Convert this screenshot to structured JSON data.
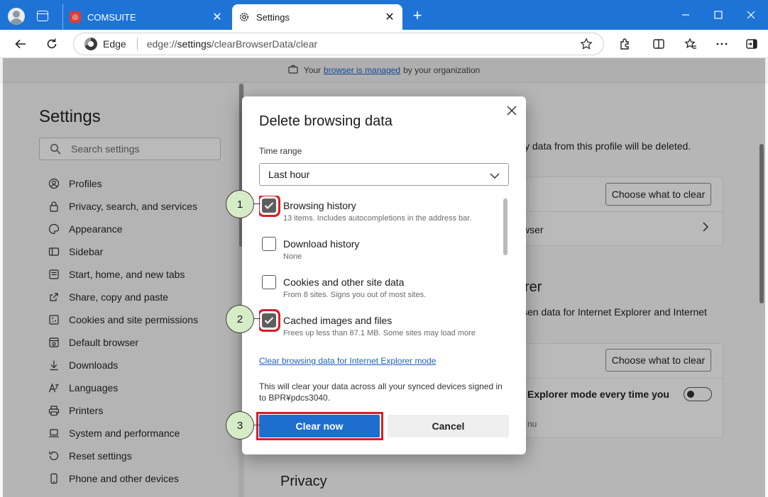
{
  "browser": {
    "tabs": [
      {
        "title": "COMSUITE",
        "active": false
      },
      {
        "title": "Settings",
        "active": true
      }
    ],
    "address": {
      "site_label": "Edge",
      "url_scheme": "edge://",
      "url_host": "settings",
      "url_path": "/clearBrowserData/clear"
    }
  },
  "banner": {
    "prefix": "Your",
    "link": "browser is managed",
    "suffix": "by your organization"
  },
  "sidebar": {
    "title": "Settings",
    "search_placeholder": "Search settings",
    "items": [
      {
        "label": "Profiles",
        "icon": "profile-icon"
      },
      {
        "label": "Privacy, search, and services",
        "icon": "lock-icon"
      },
      {
        "label": "Appearance",
        "icon": "palette-icon"
      },
      {
        "label": "Sidebar",
        "icon": "sidebar-icon"
      },
      {
        "label": "Start, home, and new tabs",
        "icon": "home-icon"
      },
      {
        "label": "Share, copy and paste",
        "icon": "share-icon"
      },
      {
        "label": "Cookies and site permissions",
        "icon": "cookies-icon"
      },
      {
        "label": "Default browser",
        "icon": "browser-icon"
      },
      {
        "label": "Downloads",
        "icon": "download-icon"
      },
      {
        "label": "Languages",
        "icon": "language-icon"
      },
      {
        "label": "Printers",
        "icon": "printer-icon"
      },
      {
        "label": "System and performance",
        "icon": "laptop-icon"
      },
      {
        "label": "Reset settings",
        "icon": "reset-icon"
      },
      {
        "label": "Phone and other devices",
        "icon": "phone-icon"
      }
    ]
  },
  "main": {
    "profile_note": "y data from this profile will be deleted.",
    "choose_label_1": "Choose what to clear",
    "row_browser": "wser",
    "heading_ie": "rer",
    "ie_desc": "sen data for Internet Explorer and Internet",
    "choose_label_2": "Choose what to clear",
    "ie_mode_label": "Explorer mode every time you",
    "ie_mode_sub": "nu",
    "privacy_heading": "Privacy"
  },
  "dialog": {
    "title": "Delete browsing data",
    "time_range_label": "Time range",
    "time_range_value": "Last hour",
    "options": [
      {
        "label": "Browsing history",
        "detail": "13 items. Includes autocompletions in the address bar.",
        "checked": true
      },
      {
        "label": "Download history",
        "detail": "None",
        "checked": false
      },
      {
        "label": "Cookies and other site data",
        "detail": "From 8 sites. Signs you out of most sites.",
        "checked": false
      },
      {
        "label": "Cached images and files",
        "detail": "Frees up less than 87.1 MB. Some sites may load more",
        "checked": true
      }
    ],
    "ie_link": "Clear browsing data for Internet Explorer mode",
    "sync_note": "This will clear your data across all your synced devices signed in to BPR¥pdcs3040.",
    "clear_label": "Clear now",
    "cancel_label": "Cancel"
  },
  "markers": [
    "1",
    "2",
    "3"
  ],
  "colors": {
    "titlebar": "#1e73d6",
    "primary_button": "#1d6ecf",
    "highlight": "#d91e2a",
    "marker_fill": "#d6ecc7"
  }
}
